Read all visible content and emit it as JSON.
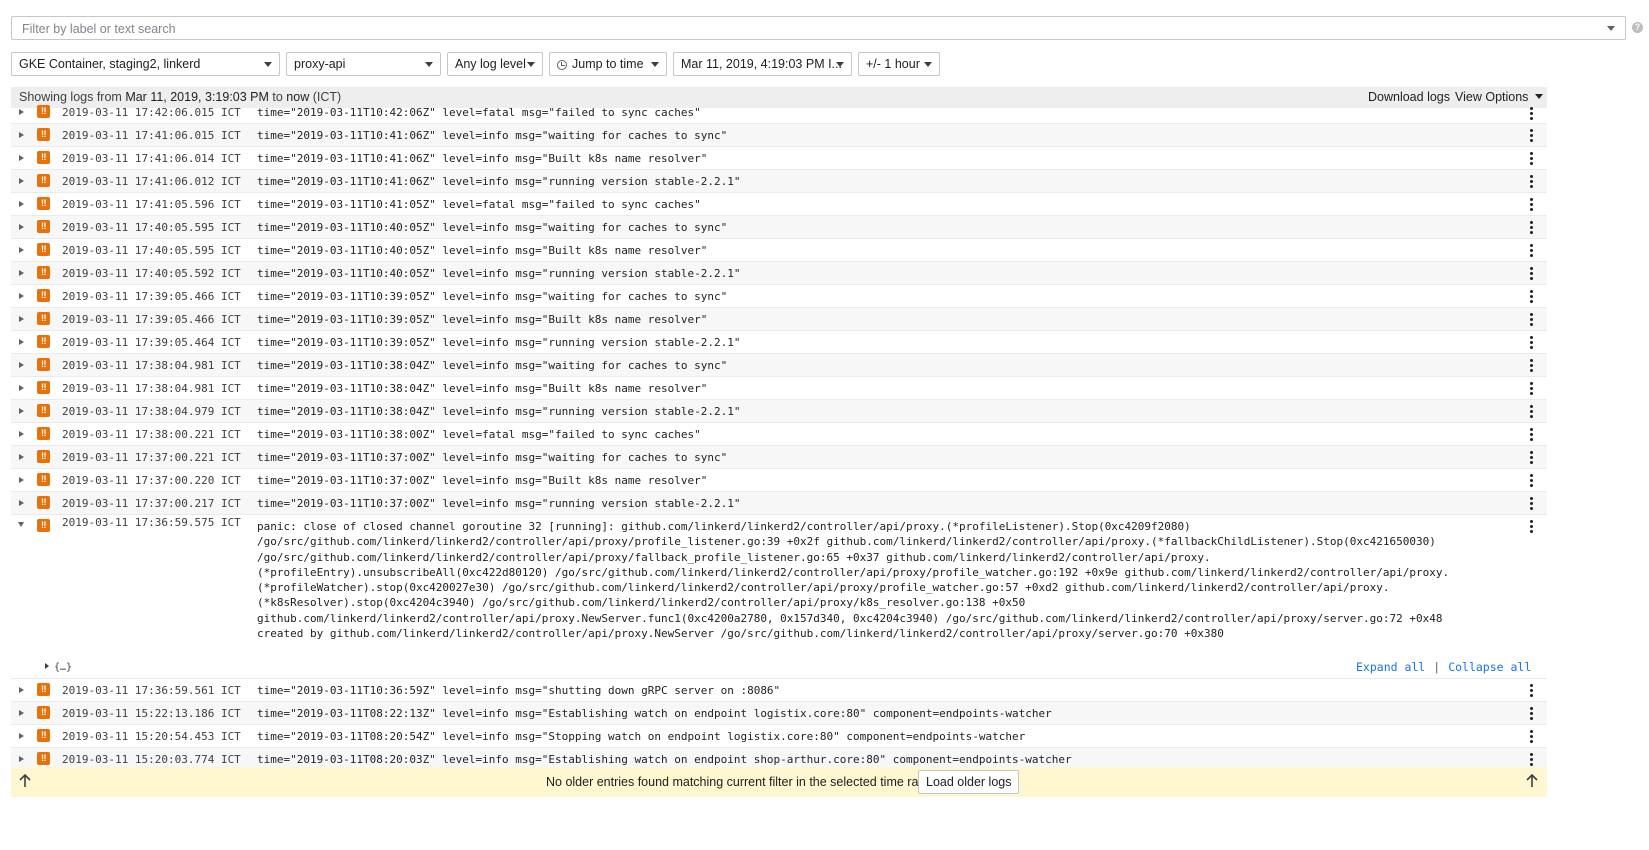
{
  "filter": {
    "placeholder": "Filter by label or text search",
    "value": ""
  },
  "help_glyph": "?",
  "dropdowns": {
    "resource": "GKE Container, staging2, linkerd",
    "log_name": "proxy-api",
    "log_level": "Any log level",
    "jump_to_time": "Jump to time",
    "time_value": "Mar 11, 2019, 4:19:03 PM I...",
    "range": "+/- 1 hour"
  },
  "header": {
    "prefix": "Showing logs from ",
    "from": "Mar 11, 2019, 3:19:03 PM",
    "mid": " to ",
    "to": "now",
    "tz": " (ICT)",
    "download": "Download logs",
    "view_options": "View Options"
  },
  "severity_glyph": "!!",
  "logs": [
    {
      "ts": "2019-03-11 17:42:06.015 ICT",
      "msg": "time=\"2019-03-11T10:42:06Z\" level=fatal msg=\"failed to sync caches\""
    },
    {
      "ts": "2019-03-11 17:41:06.015 ICT",
      "msg": "time=\"2019-03-11T10:41:06Z\" level=info msg=\"waiting for caches to sync\""
    },
    {
      "ts": "2019-03-11 17:41:06.014 ICT",
      "msg": "time=\"2019-03-11T10:41:06Z\" level=info msg=\"Built k8s name resolver\""
    },
    {
      "ts": "2019-03-11 17:41:06.012 ICT",
      "msg": "time=\"2019-03-11T10:41:06Z\" level=info msg=\"running version stable-2.2.1\""
    },
    {
      "ts": "2019-03-11 17:41:05.596 ICT",
      "msg": "time=\"2019-03-11T10:41:05Z\" level=fatal msg=\"failed to sync caches\""
    },
    {
      "ts": "2019-03-11 17:40:05.595 ICT",
      "msg": "time=\"2019-03-11T10:40:05Z\" level=info msg=\"waiting for caches to sync\""
    },
    {
      "ts": "2019-03-11 17:40:05.595 ICT",
      "msg": "time=\"2019-03-11T10:40:05Z\" level=info msg=\"Built k8s name resolver\""
    },
    {
      "ts": "2019-03-11 17:40:05.592 ICT",
      "msg": "time=\"2019-03-11T10:40:05Z\" level=info msg=\"running version stable-2.2.1\""
    },
    {
      "ts": "2019-03-11 17:39:05.466 ICT",
      "msg": "time=\"2019-03-11T10:39:05Z\" level=info msg=\"waiting for caches to sync\""
    },
    {
      "ts": "2019-03-11 17:39:05.466 ICT",
      "msg": "time=\"2019-03-11T10:39:05Z\" level=info msg=\"Built k8s name resolver\""
    },
    {
      "ts": "2019-03-11 17:39:05.464 ICT",
      "msg": "time=\"2019-03-11T10:39:05Z\" level=info msg=\"running version stable-2.2.1\""
    },
    {
      "ts": "2019-03-11 17:38:04.981 ICT",
      "msg": "time=\"2019-03-11T10:38:04Z\" level=info msg=\"waiting for caches to sync\""
    },
    {
      "ts": "2019-03-11 17:38:04.981 ICT",
      "msg": "time=\"2019-03-11T10:38:04Z\" level=info msg=\"Built k8s name resolver\""
    },
    {
      "ts": "2019-03-11 17:38:04.979 ICT",
      "msg": "time=\"2019-03-11T10:38:04Z\" level=info msg=\"running version stable-2.2.1\""
    },
    {
      "ts": "2019-03-11 17:38:00.221 ICT",
      "msg": "time=\"2019-03-11T10:38:00Z\" level=fatal msg=\"failed to sync caches\""
    },
    {
      "ts": "2019-03-11 17:37:00.221 ICT",
      "msg": "time=\"2019-03-11T10:37:00Z\" level=info msg=\"waiting for caches to sync\""
    },
    {
      "ts": "2019-03-11 17:37:00.220 ICT",
      "msg": "time=\"2019-03-11T10:37:00Z\" level=info msg=\"Built k8s name resolver\""
    },
    {
      "ts": "2019-03-11 17:37:00.217 ICT",
      "msg": "time=\"2019-03-11T10:37:00Z\" level=info msg=\"running version stable-2.2.1\""
    }
  ],
  "expanded_log": {
    "ts": "2019-03-11 17:36:59.575 ICT",
    "lines": [
      "panic: close of closed channel goroutine 32 [running]: github.com/linkerd/linkerd2/controller/api/proxy.(*profileListener).Stop(0xc4209f2080)",
      "/go/src/github.com/linkerd/linkerd2/controller/api/proxy/profile_listener.go:39 +0x2f github.com/linkerd/linkerd2/controller/api/proxy.(*fallbackChildListener).Stop(0xc421650030)",
      "/go/src/github.com/linkerd/linkerd2/controller/api/proxy/fallback_profile_listener.go:65 +0x37 github.com/linkerd/linkerd2/controller/api/proxy.",
      "(*profileEntry).unsubscribeAll(0xc422d80120) /go/src/github.com/linkerd/linkerd2/controller/api/proxy/profile_watcher.go:192 +0x9e github.com/linkerd/linkerd2/controller/api/proxy.",
      "(*profileWatcher).stop(0xc420027e30) /go/src/github.com/linkerd/linkerd2/controller/api/proxy/profile_watcher.go:57 +0xd2 github.com/linkerd/linkerd2/controller/api/proxy.",
      "(*k8sResolver).stop(0xc4204c3940) /go/src/github.com/linkerd/linkerd2/controller/api/proxy/k8s_resolver.go:138 +0x50",
      "github.com/linkerd/linkerd2/controller/api/proxy.NewServer.func1(0xc4200a2780, 0x157d340, 0xc4204c3940) /go/src/github.com/linkerd/linkerd2/controller/api/proxy/server.go:72 +0x48",
      "created by github.com/linkerd/linkerd2/controller/api/proxy.NewServer /go/src/github.com/linkerd/linkerd2/controller/api/proxy/server.go:70 +0x380"
    ],
    "json_summary": "{…}",
    "expand_all": "Expand all",
    "separator": "|",
    "collapse_all": "Collapse all"
  },
  "later_logs": [
    {
      "ts": "2019-03-11 17:36:59.561 ICT",
      "msg": "time=\"2019-03-11T10:36:59Z\" level=info msg=\"shutting down gRPC server on :8086\""
    },
    {
      "ts": "2019-03-11 15:22:13.186 ICT",
      "msg": "time=\"2019-03-11T08:22:13Z\" level=info msg=\"Establishing watch on endpoint logistix.core:80\" component=endpoints-watcher"
    },
    {
      "ts": "2019-03-11 15:20:54.453 ICT",
      "msg": "time=\"2019-03-11T08:20:54Z\" level=info msg=\"Stopping watch on endpoint logistix.core:80\" component=endpoints-watcher"
    },
    {
      "ts": "2019-03-11 15:20:03.774 ICT",
      "msg": "time=\"2019-03-11T08:20:03Z\" level=info msg=\"Establishing watch on endpoint shop-arthur.core:80\" component=endpoints-watcher"
    }
  ],
  "footer": {
    "notice": "No older entries found matching current filter in the selected time range.",
    "load_button": "Load older logs"
  },
  "colors": {
    "severity": "#e8710a",
    "link": "#1a73e8",
    "footer_bg": "#fef7d0",
    "header_bg": "#eeeeee"
  }
}
